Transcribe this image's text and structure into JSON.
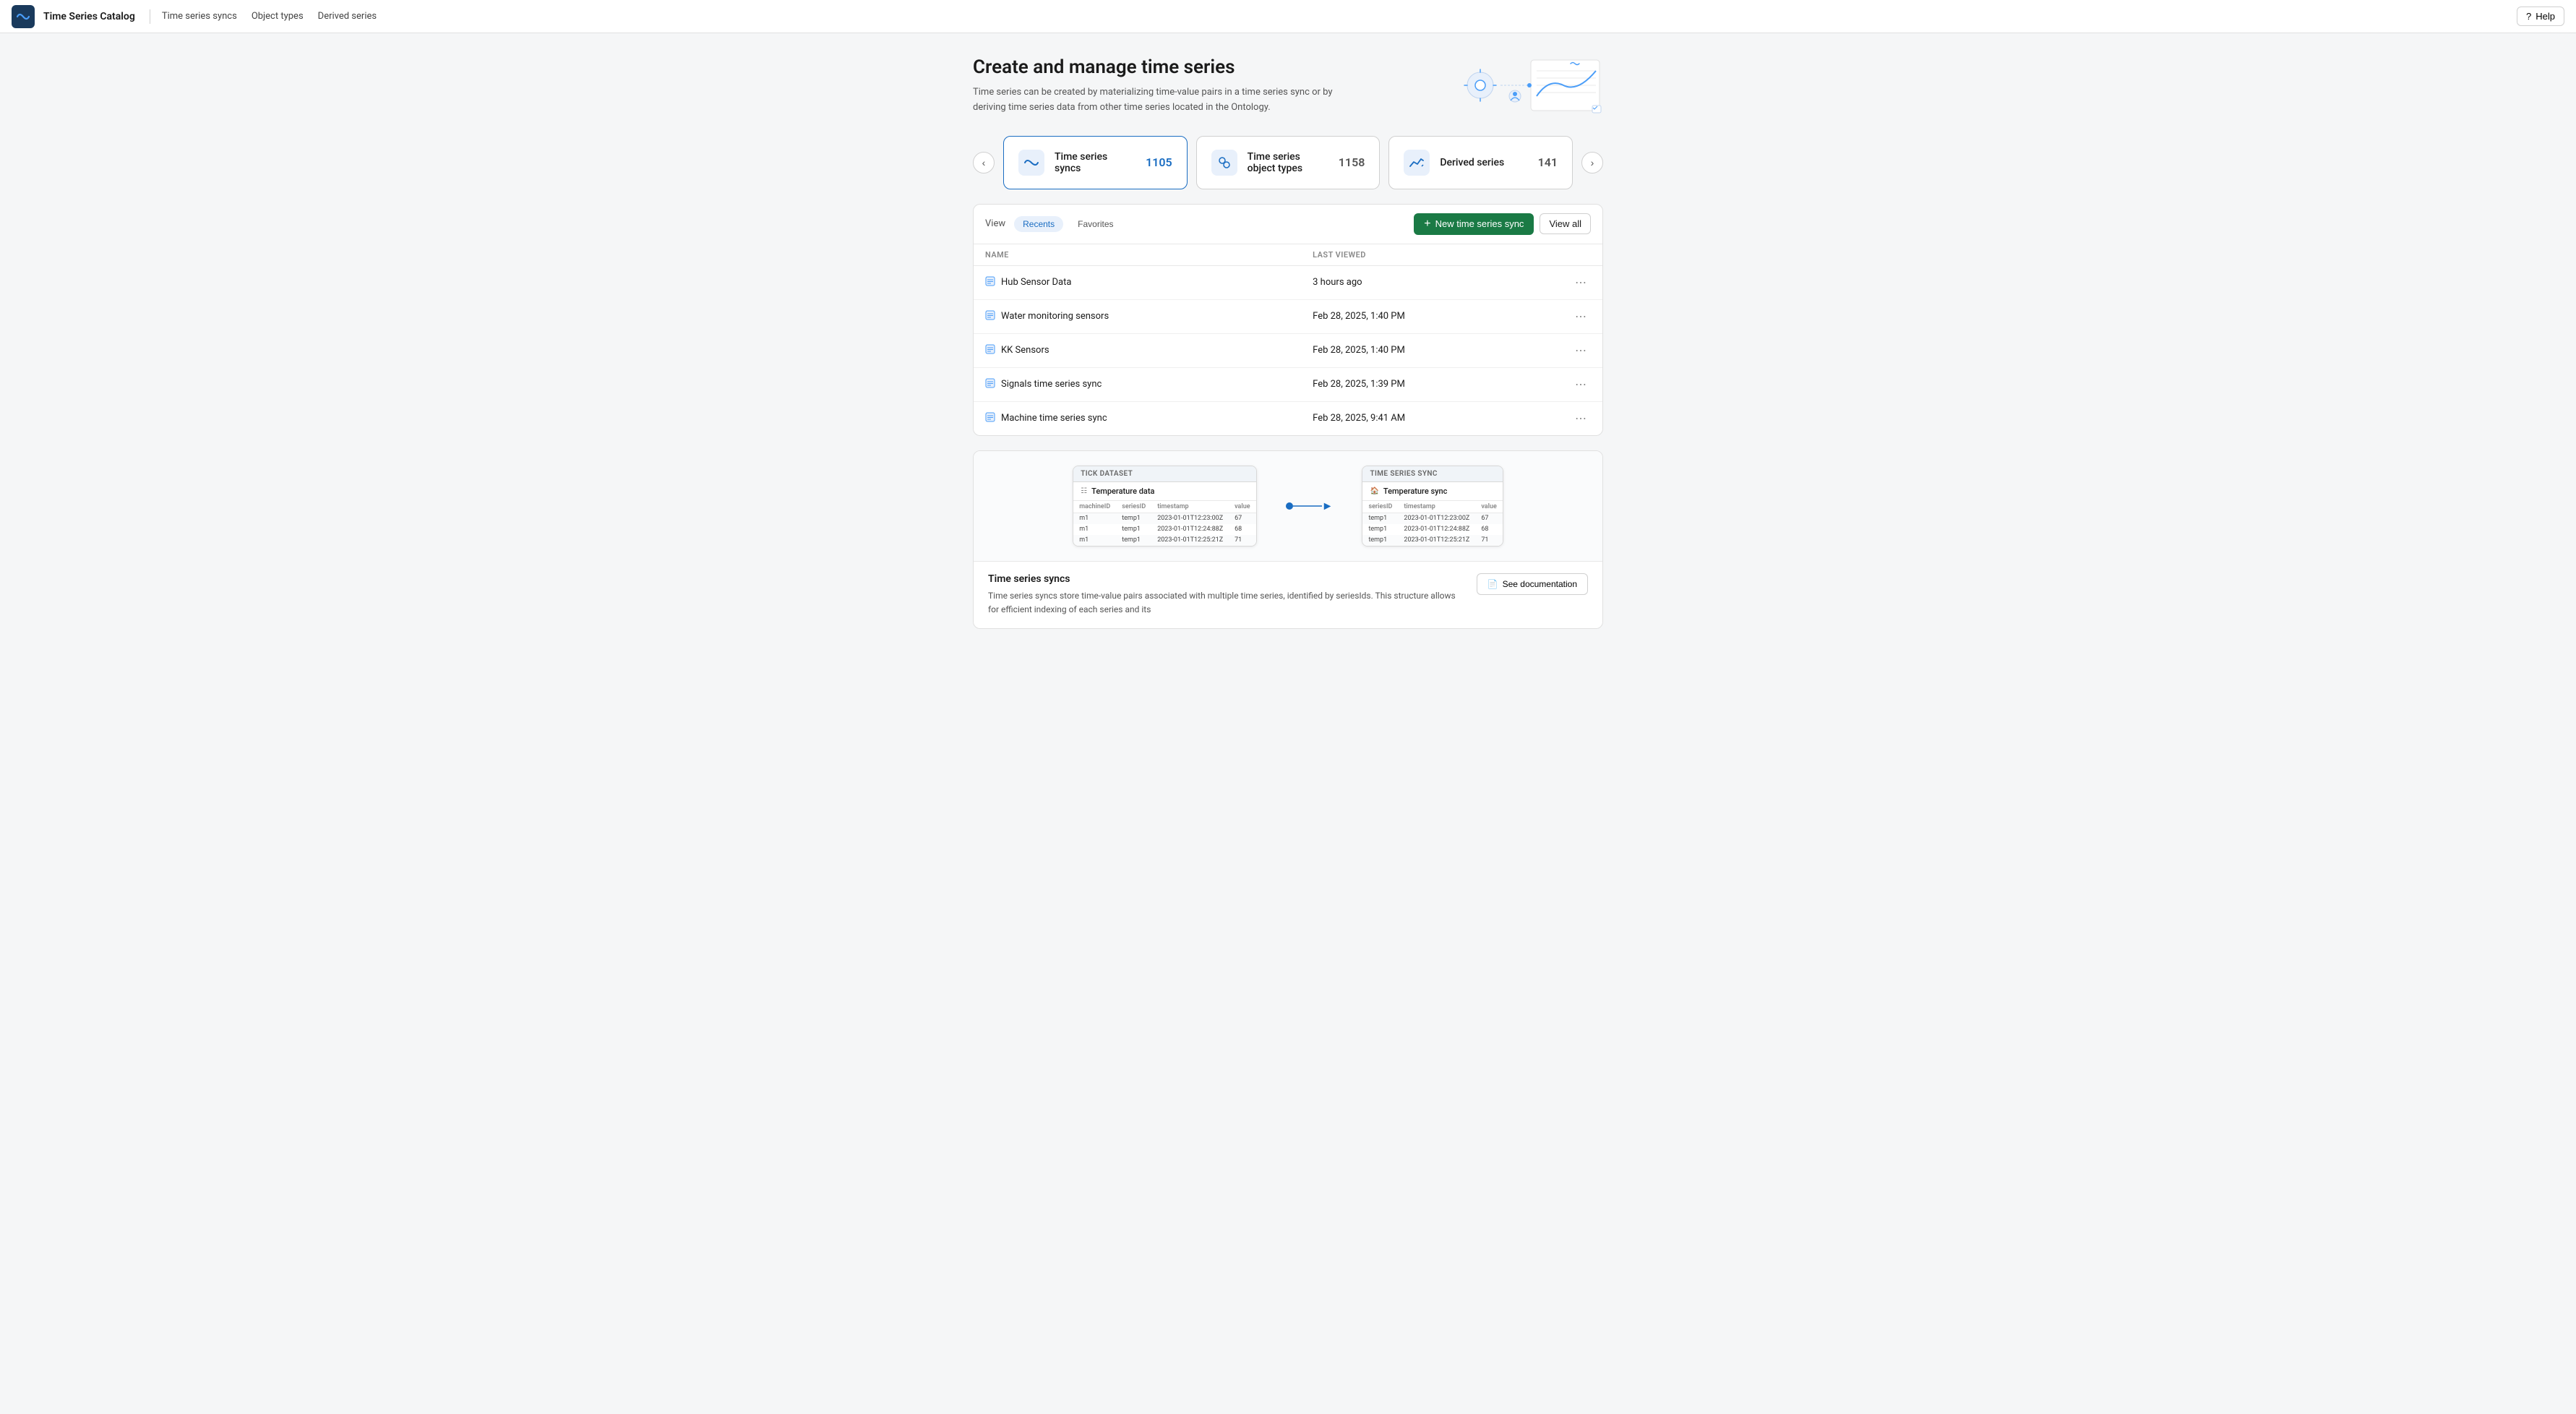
{
  "topnav": {
    "title": "Time Series Catalog",
    "links": [
      "Time series syncs",
      "Object types",
      "Derived series"
    ],
    "help_label": "Help"
  },
  "hero": {
    "title": "Create and manage time series",
    "description": "Time series can be created by materializing time-value pairs in a time series sync or by deriving time series data from other time series located in the Ontology."
  },
  "cards": [
    {
      "label": "Time series syncs",
      "count": "1105",
      "active": true
    },
    {
      "label": "Time series object types",
      "count": "1158",
      "active": false
    },
    {
      "label": "Derived series",
      "count": "141",
      "active": false
    }
  ],
  "toolbar": {
    "view_label": "View",
    "tabs": [
      "Recents",
      "Favorites"
    ],
    "active_tab": "Recents",
    "new_btn_label": "New time series sync",
    "view_all_label": "View all"
  },
  "table": {
    "columns": [
      "NAME",
      "LAST VIEWED"
    ],
    "rows": [
      {
        "name": "Hub Sensor Data",
        "last_viewed": "3 hours ago"
      },
      {
        "name": "Water monitoring sensors",
        "last_viewed": "Feb 28, 2025, 1:40 PM"
      },
      {
        "name": "KK Sensors",
        "last_viewed": "Feb 28, 2025, 1:40 PM"
      },
      {
        "name": "Signals time series sync",
        "last_viewed": "Feb 28, 2025, 1:39 PM"
      },
      {
        "name": "Machine time series sync",
        "last_viewed": "Feb 28, 2025, 9:41 AM"
      }
    ]
  },
  "diagram": {
    "left_header": "TICK DATASET",
    "left_title": "Temperature data",
    "left_columns": [
      "machineID",
      "seriesID",
      "timestamp",
      "value"
    ],
    "left_rows": [
      [
        "m1",
        "temp1",
        "2023-01-01T12:23:00Z",
        "67"
      ],
      [
        "m1",
        "temp1",
        "2023-01-01T12:24:88Z",
        "68"
      ],
      [
        "m1",
        "temp1",
        "2023-01-01T12:25:21Z",
        "71"
      ]
    ],
    "right_header": "TIME SERIES SYNC",
    "right_title": "Temperature sync",
    "right_columns": [
      "seriesID",
      "timestamp",
      "value"
    ],
    "right_rows": [
      [
        "temp1",
        "2023-01-01T12:23:00Z",
        "67"
      ],
      [
        "temp1",
        "2023-01-01T12:24:88Z",
        "68"
      ],
      [
        "temp1",
        "2023-01-01T12:25:21Z",
        "71"
      ]
    ]
  },
  "bottom": {
    "title": "Time series syncs",
    "description": "Time series syncs store time-value pairs associated with multiple time series, identified by seriesIds. This structure allows for efficient indexing of each series and its",
    "doc_label": "See documentation"
  },
  "colors": {
    "active_card_border": "#1a6dc2",
    "new_btn_bg": "#1a7a45",
    "accent": "#1a6dc2"
  }
}
